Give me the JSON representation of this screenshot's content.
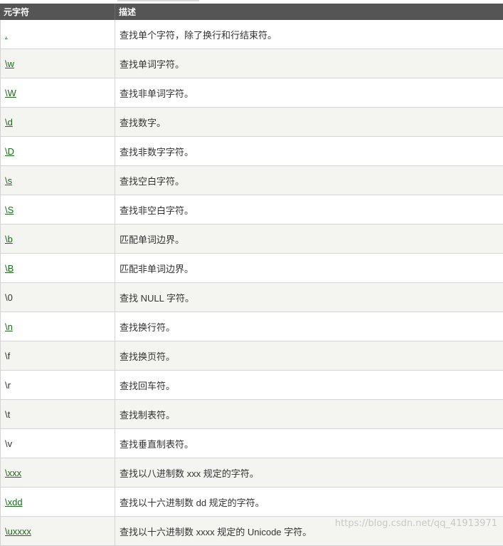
{
  "header": {
    "col1": "元字符",
    "col2": "描述"
  },
  "rows": [
    {
      "char": ".",
      "desc": "查找单个字符，除了换行和行结束符。",
      "link": true
    },
    {
      "char": "\\w",
      "desc": "查找单词字符。",
      "link": true
    },
    {
      "char": "\\W",
      "desc": "查找非单词字符。",
      "link": true
    },
    {
      "char": "\\d",
      "desc": "查找数字。",
      "link": true
    },
    {
      "char": "\\D",
      "desc": "查找非数字字符。",
      "link": true
    },
    {
      "char": "\\s",
      "desc": "查找空白字符。",
      "link": true
    },
    {
      "char": "\\S",
      "desc": "查找非空白字符。",
      "link": true
    },
    {
      "char": "\\b",
      "desc": "匹配单词边界。",
      "link": true
    },
    {
      "char": "\\B",
      "desc": "匹配非单词边界。",
      "link": true
    },
    {
      "char": "\\0",
      "desc": "查找 NULL 字符。",
      "link": false
    },
    {
      "char": "\\n",
      "desc": "查找换行符。",
      "link": true
    },
    {
      "char": "\\f",
      "desc": "查找换页符。",
      "link": false
    },
    {
      "char": "\\r",
      "desc": "查找回车符。",
      "link": false
    },
    {
      "char": "\\t",
      "desc": "查找制表符。",
      "link": false
    },
    {
      "char": "\\v",
      "desc": "查找垂直制表符。",
      "link": false
    },
    {
      "char": "\\xxx",
      "desc": "查找以八进制数 xxx 规定的字符。",
      "link": true
    },
    {
      "char": "\\xdd",
      "desc": "查找以十六进制数 dd 规定的字符。",
      "link": true
    },
    {
      "char": "\\uxxxx",
      "desc": "查找以十六进制数 xxxx 规定的 Unicode 字符。",
      "link": true
    }
  ],
  "watermark": "https://blog.csdn.net/qq_41913971",
  "colors": {
    "header_bg": "#555555",
    "link": "#1a6a1a",
    "row_alt": "#f4f4f0"
  }
}
